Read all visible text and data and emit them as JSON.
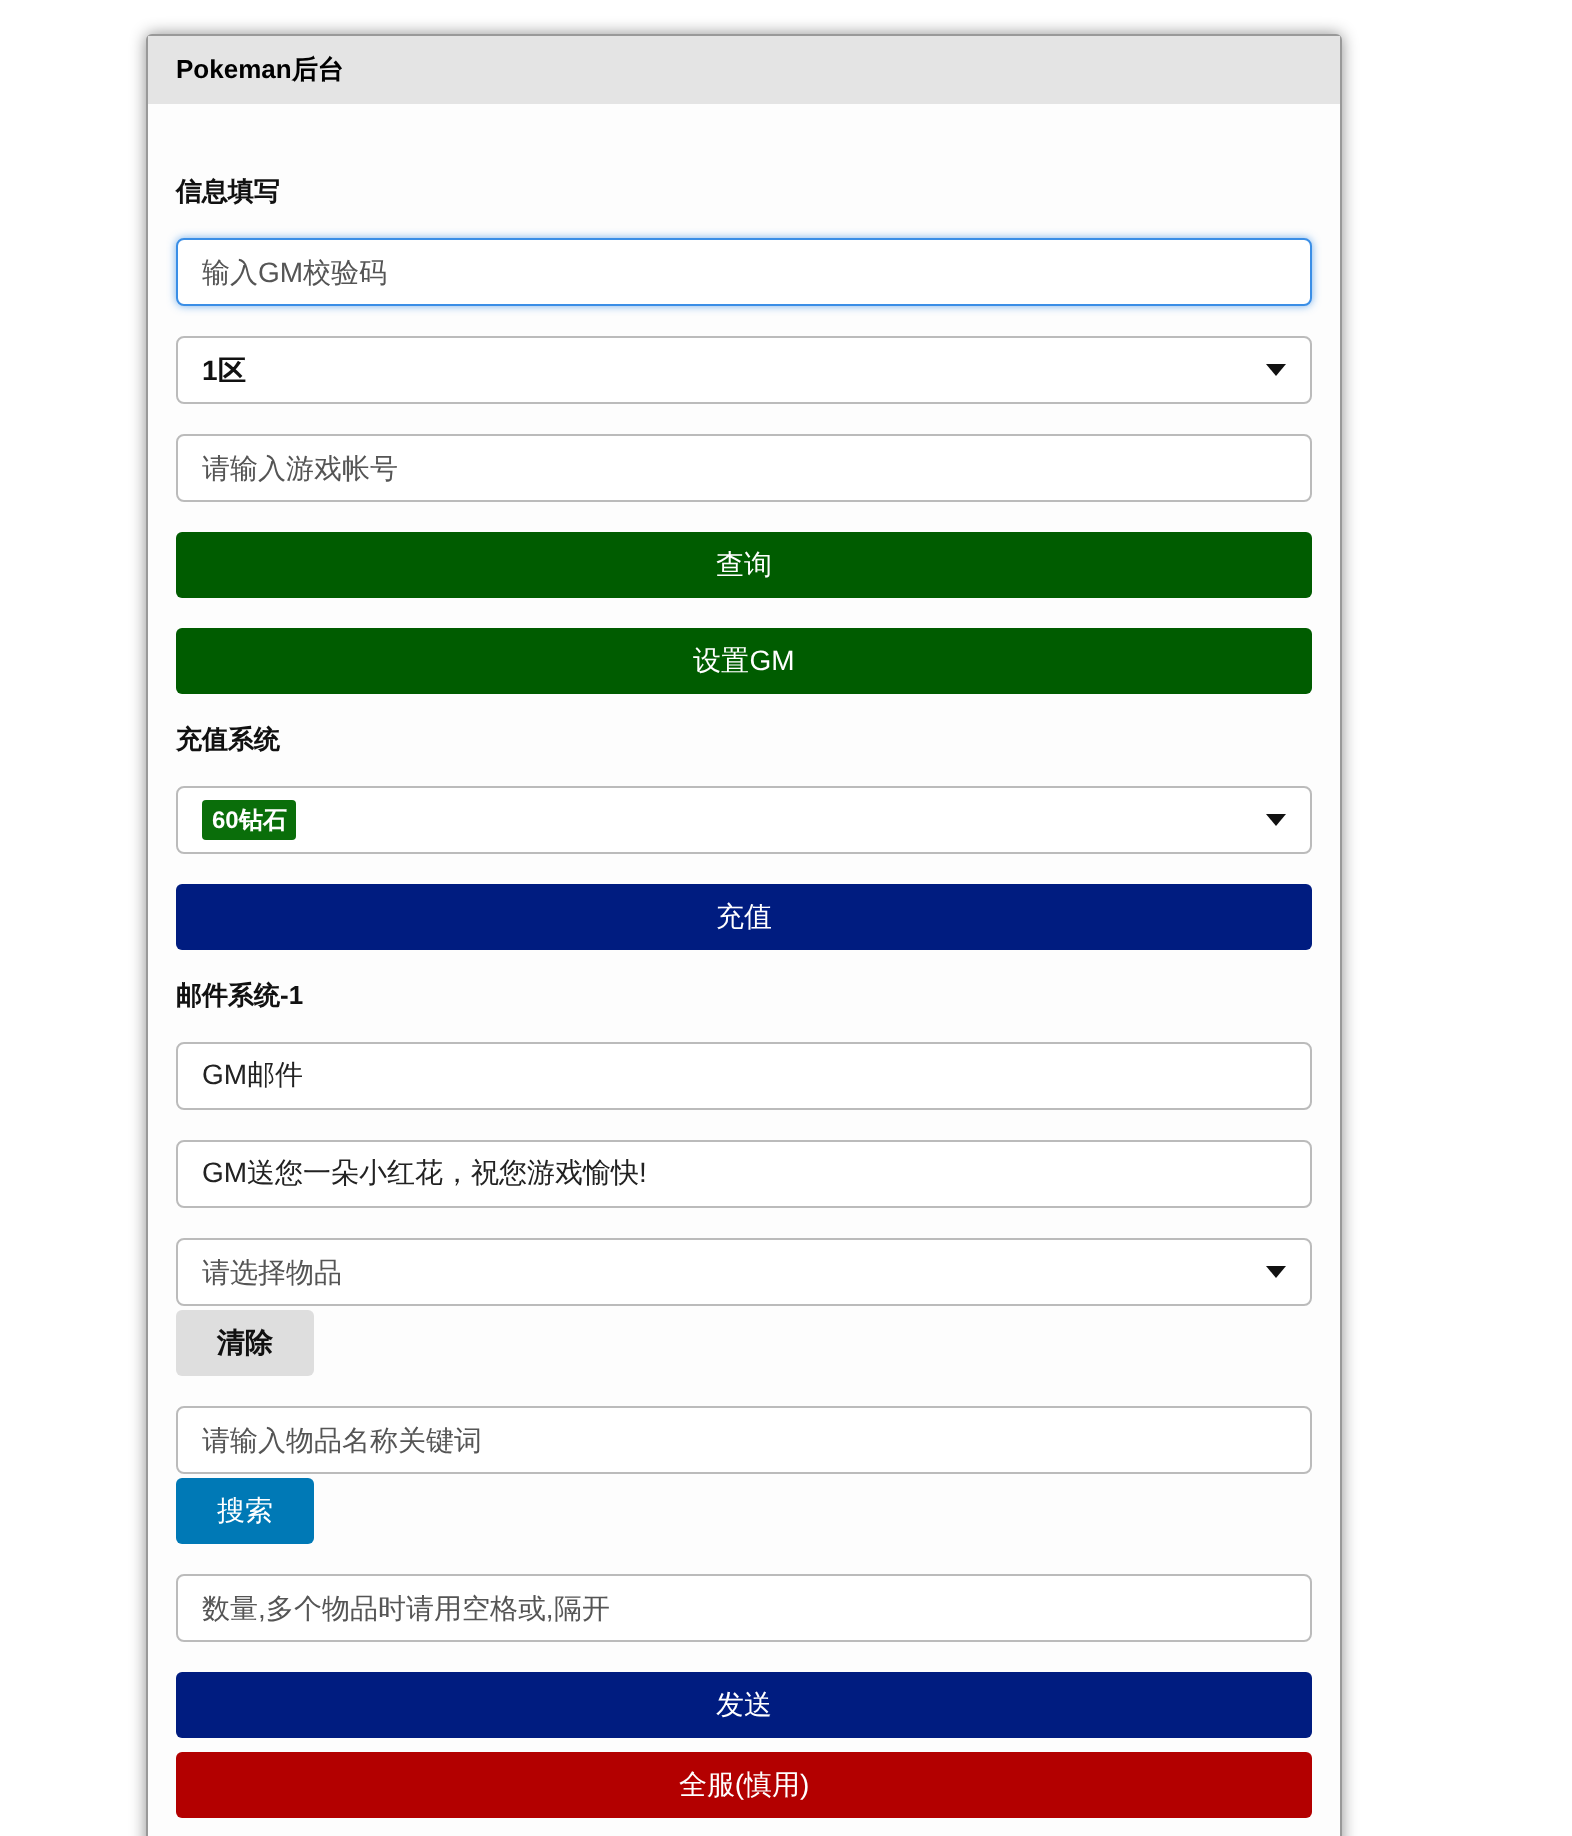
{
  "window": {
    "title": "Pokeman后台"
  },
  "sections": [
    {
      "title": "信息填写",
      "controls": [
        {
          "kind": "input",
          "placeholder": "输入GM校验码",
          "focused": true
        },
        {
          "kind": "select",
          "value": "1区",
          "tag": false
        },
        {
          "kind": "input",
          "placeholder": "请输入游戏帐号",
          "focused": false
        },
        {
          "kind": "button",
          "label": "查询",
          "color": "#005c00"
        },
        {
          "kind": "button",
          "label": "设置GM",
          "color": "#005c00"
        }
      ]
    },
    {
      "title": "充值系统",
      "controls": [
        {
          "kind": "select",
          "value": "60钻石",
          "tag": true
        },
        {
          "kind": "button",
          "label": "充值",
          "color": "#001c80"
        }
      ]
    },
    {
      "title": "邮件系统-1",
      "controls": [
        {
          "kind": "input",
          "value": "GM邮件",
          "focused": false
        },
        {
          "kind": "input",
          "value": "GM送您一朵小红花，祝您游戏愉快!",
          "focused": false
        },
        {
          "kind": "select",
          "placeholder": "请选择物品"
        },
        {
          "kind": "small_button",
          "label": "清除",
          "color": "#dedede"
        },
        {
          "kind": "input",
          "placeholder": "请输入物品名称关键词",
          "focused": false
        },
        {
          "kind": "small_button",
          "label": "搜索",
          "color": "#0079b6"
        },
        {
          "kind": "input",
          "placeholder": "数量,多个物品时请用空格或,隔开",
          "focused": false
        },
        {
          "kind": "button",
          "label": "发送",
          "color": "#001c80"
        },
        {
          "kind": "button",
          "label": "全服(慎用)",
          "color": "#b30000"
        }
      ]
    }
  ]
}
